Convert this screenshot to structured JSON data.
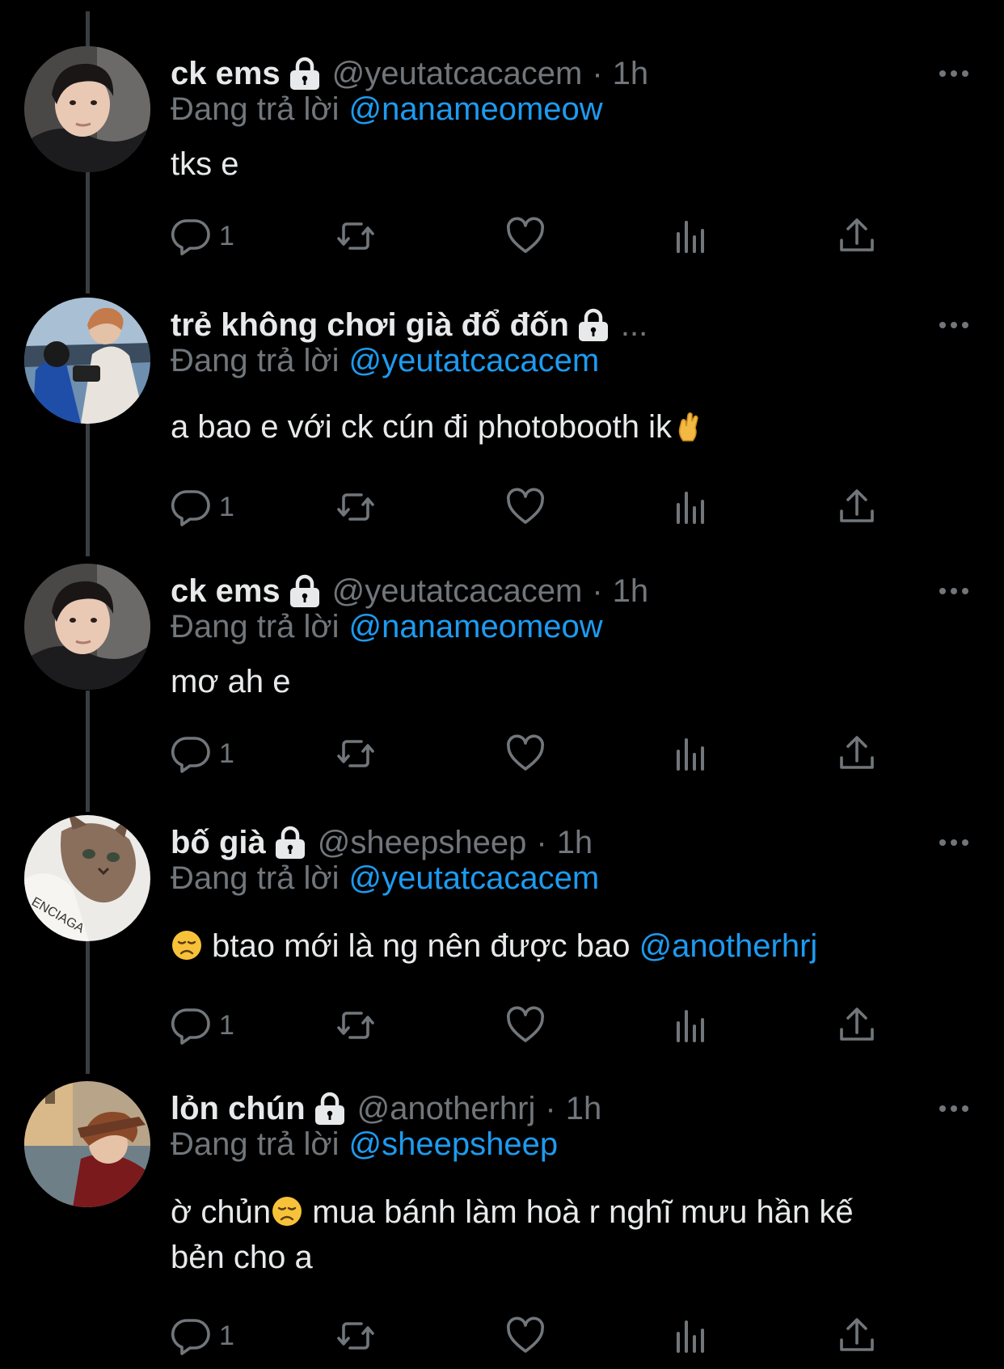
{
  "tweets": [
    {
      "name": "ck ems",
      "handle": "@yeutatcacacem",
      "dot": "·",
      "time": "1h",
      "replying_prefix": "Đang trả lời",
      "replying_to": "@nanameomeow",
      "body": "tks e",
      "reply_count": "1"
    },
    {
      "name": "trẻ không chơi già đổ đốn",
      "handle_truncated": "...",
      "replying_prefix": "Đang trả lời",
      "replying_to": "@yeutatcacacem",
      "body": "a bao e với ck cún đi photobooth ik",
      "body_emoji": "crossed-fingers-emoji",
      "reply_count": "1"
    },
    {
      "name": "ck ems",
      "handle": "@yeutatcacacem",
      "dot": "·",
      "time": "1h",
      "replying_prefix": "Đang trả lời",
      "replying_to": "@nanameomeow",
      "body": "mơ ah e",
      "reply_count": "1"
    },
    {
      "name": "bố già",
      "handle": "@sheepsheep",
      "dot": "·",
      "time": "1h",
      "replying_prefix": "Đang trả lời",
      "replying_to": "@yeutatcacacem",
      "body_emoji": "disappointed-face-emoji",
      "body": " btao mới là ng nên được bao ",
      "body_mention": "@anotherhrj",
      "reply_count": "1"
    },
    {
      "name": "lỏn chún",
      "handle": "@anotherhrj",
      "dot": "·",
      "time": "1h",
      "replying_prefix": "Đang trả lời",
      "replying_to": "@sheepsheep",
      "body_line1_a": "ờ chủn",
      "body_emoji": "disappointed-face-emoji",
      "body_line1_b": " mua bánh làm hoà r nghĩ mưu hần kế",
      "body_line2": "bẻn cho a",
      "reply_count": "1"
    }
  ],
  "icons": {
    "lock": "lock-icon",
    "more": "more-options-icon",
    "reply": "reply-icon",
    "retweet": "retweet-icon",
    "like": "heart-icon",
    "views": "views-icon",
    "share": "share-icon"
  },
  "colors": {
    "background": "#000000",
    "text": "#e7e9ea",
    "secondary": "#71767b",
    "link": "#1d9bf0",
    "thread_line": "#3a3d41"
  }
}
